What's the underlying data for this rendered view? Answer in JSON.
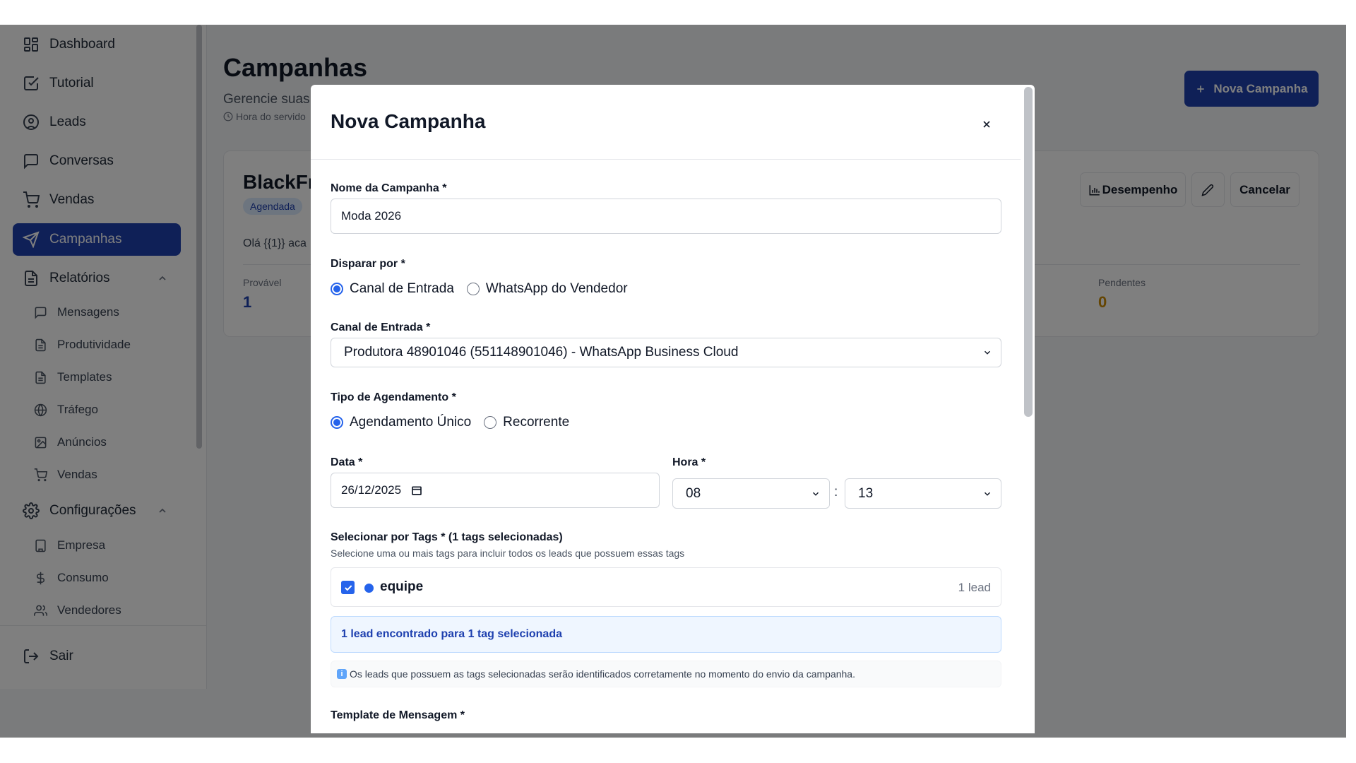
{
  "sidebar": {
    "items": [
      {
        "label": "Dashboard",
        "icon": "dashboard-icon"
      },
      {
        "label": "Tutorial",
        "icon": "checkbox-icon"
      },
      {
        "label": "Leads",
        "icon": "user-circle-icon"
      },
      {
        "label": "Conversas",
        "icon": "chat-icon"
      },
      {
        "label": "Vendas",
        "icon": "cart-icon"
      },
      {
        "label": "Campanhas",
        "icon": "send-icon"
      }
    ],
    "reports": {
      "label": "Relatórios",
      "icon": "document-icon"
    },
    "report_items": [
      {
        "label": "Mensagens",
        "icon": "message-icon"
      },
      {
        "label": "Produtividade",
        "icon": "file-icon"
      },
      {
        "label": "Templates",
        "icon": "file-icon"
      },
      {
        "label": "Tráfego",
        "icon": "globe-icon"
      },
      {
        "label": "Anúncios",
        "icon": "image-icon"
      },
      {
        "label": "Vendas",
        "icon": "cart-icon"
      }
    ],
    "settings": {
      "label": "Configurações",
      "icon": "gear-icon"
    },
    "settings_items": [
      {
        "label": "Empresa",
        "icon": "building-icon"
      },
      {
        "label": "Consumo",
        "icon": "dollar-icon"
      },
      {
        "label": "Vendedores",
        "icon": "users-icon"
      }
    ],
    "logout": {
      "label": "Sair",
      "icon": "logout-icon"
    }
  },
  "page": {
    "title": "Campanhas",
    "subtitle": "Gerencie suas",
    "server_time": "Hora do servido",
    "new_button": "Nova Campanha"
  },
  "campaign": {
    "name": "BlackFr",
    "status": "Agendada",
    "message": "Olá {{1}} aca",
    "stats": {
      "provavel_label": "Provável",
      "provavel_value": "1",
      "pendentes_label": "Pendentes",
      "pendentes_value": "0"
    },
    "buttons": {
      "performance": "Desempenho",
      "cancel": "Cancelar"
    }
  },
  "modal": {
    "title": "Nova Campanha",
    "name_label": "Nome da Campanha *",
    "name_value": "Moda 2026",
    "trigger_label": "Disparar por *",
    "trigger_options": [
      "Canal de Entrada",
      "WhatsApp do Vendedor"
    ],
    "trigger_selected": "Canal de Entrada",
    "channel_label": "Canal de Entrada *",
    "channel_value": "Produtora 48901046 (551148901046) - WhatsApp Business Cloud",
    "schedule_label": "Tipo de Agendamento *",
    "schedule_options": [
      "Agendamento Único",
      "Recorrente"
    ],
    "schedule_selected": "Agendamento Único",
    "date_label": "Data *",
    "date_value": "26/12/2025",
    "time_label": "Hora *",
    "hour_value": "08",
    "time_separator": ":",
    "minute_value": "13",
    "tags_label": "Selecionar por Tags * (1 tags selecionadas)",
    "tags_hint": "Selecione uma ou mais tags para incluir todos os leads que possuem essas tags",
    "tags": [
      {
        "name": "equipe",
        "count": "1 lead",
        "checked": true,
        "color": "#2563eb"
      }
    ],
    "found_text": "1 lead encontrado para 1 tag selecionada",
    "note_text": "Os leads que possuem as tags selecionadas serão identificados corretamente no momento do envio da campanha.",
    "note_icon": "info-icon",
    "template_label": "Template de Mensagem *"
  },
  "colors": {
    "primary": "#1e40af",
    "accent": "#2563eb",
    "pending": "#ca8a04",
    "overlay": "rgba(0,0,0,0.5)"
  }
}
